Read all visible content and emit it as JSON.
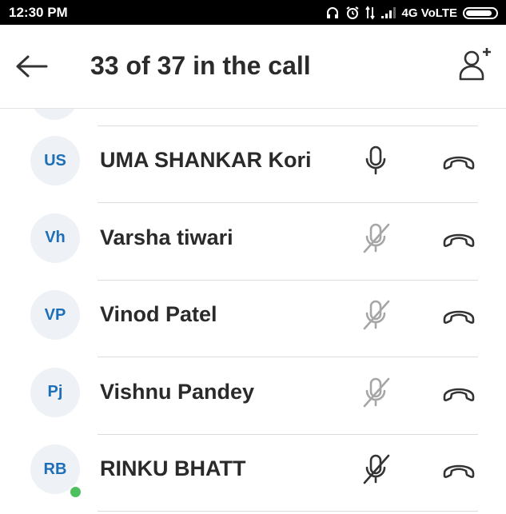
{
  "status_bar": {
    "time": "12:30 PM",
    "network_label": "4G VoLTE",
    "icons": [
      "headphones-icon",
      "alarm-icon",
      "data-arrows-icon",
      "signal-icon",
      "battery-icon"
    ]
  },
  "header": {
    "title": "33 of 37 in the call",
    "back_icon": "arrow-left-icon",
    "add_icon": "add-person-icon"
  },
  "participants": [
    {
      "initials": "US",
      "name": "UMA SHANKAR Kori",
      "mic": "on",
      "online": false
    },
    {
      "initials": "Vh",
      "name": "Varsha tiwari",
      "mic": "off",
      "online": false
    },
    {
      "initials": "VP",
      "name": "Vinod Patel",
      "mic": "off",
      "online": false
    },
    {
      "initials": "Pj",
      "name": "Vishnu Pandey",
      "mic": "off",
      "online": false
    },
    {
      "initials": "RB",
      "name": "RINKU BHATT",
      "mic": "muted",
      "online": true
    }
  ],
  "colors": {
    "initials": "#1d6fb8",
    "avatar_bg": "#eef1f5",
    "online": "#4fc060",
    "mic_on": "#333333",
    "mic_off": "#a6a6a6",
    "mic_muted": "#333333"
  }
}
